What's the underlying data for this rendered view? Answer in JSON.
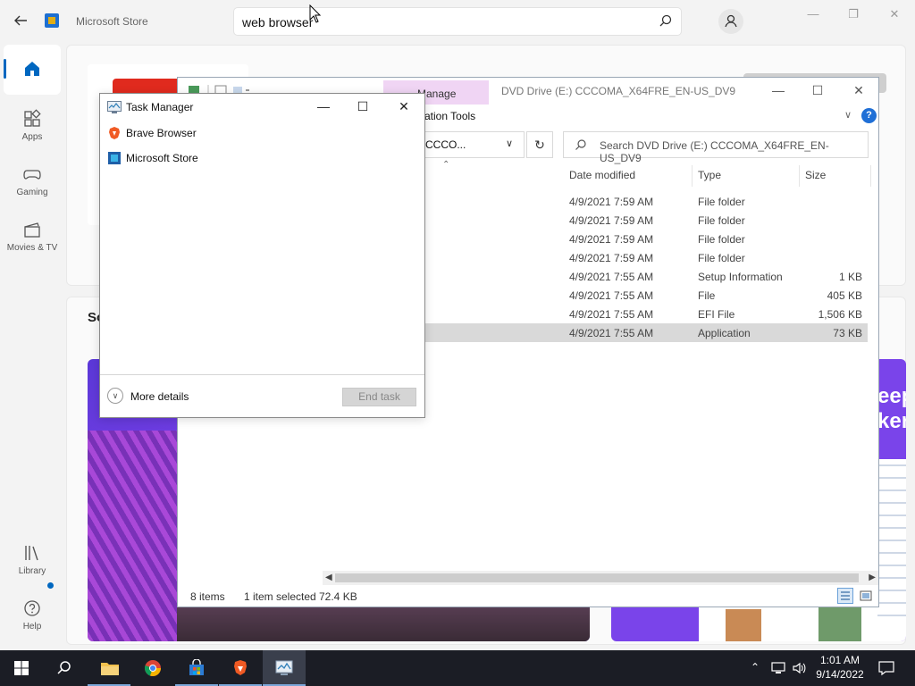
{
  "store": {
    "app_title": "Microsoft Store",
    "search_value": "web browser",
    "partial_section_title": "So",
    "tile_text_line1": "eep",
    "tile_text_line2": "kers",
    "nav": [
      {
        "label": "",
        "icon": "home-icon",
        "active": true
      },
      {
        "label": "Apps",
        "icon": "apps-icon"
      },
      {
        "label": "Gaming",
        "icon": "gaming-icon"
      },
      {
        "label": "Movies & TV",
        "icon": "movies-icon"
      },
      {
        "label": "Library",
        "icon": "library-icon",
        "badge": true
      },
      {
        "label": "Help",
        "icon": "help-icon"
      }
    ]
  },
  "explorer": {
    "title": "DVD Drive (E:) CCCOMA_X64FRE_EN-US_DV9",
    "ribbon_context_tab": "Manage",
    "ribbon_context_group": "ation Tools",
    "address_text": "CCCO...",
    "search_placeholder": "Search DVD Drive (E:) CCCOMA_X64FRE_EN-US_DV9",
    "columns": {
      "date": "Date modified",
      "type": "Type",
      "size": "Size"
    },
    "rows": [
      {
        "date": "4/9/2021 7:59 AM",
        "type": "File folder",
        "size": ""
      },
      {
        "date": "4/9/2021 7:59 AM",
        "type": "File folder",
        "size": ""
      },
      {
        "date": "4/9/2021 7:59 AM",
        "type": "File folder",
        "size": ""
      },
      {
        "date": "4/9/2021 7:59 AM",
        "type": "File folder",
        "size": ""
      },
      {
        "date": "4/9/2021 7:55 AM",
        "type": "Setup Information",
        "size": "1 KB"
      },
      {
        "date": "4/9/2021 7:55 AM",
        "type": "File",
        "size": "405 KB"
      },
      {
        "date": "4/9/2021 7:55 AM",
        "type": "EFI File",
        "size": "1,506 KB"
      },
      {
        "date": "4/9/2021 7:55 AM",
        "type": "Application",
        "size": "73 KB",
        "selected": true
      }
    ],
    "status": {
      "items": "8 items",
      "selected": "1 item selected",
      "size": "72.4 KB"
    }
  },
  "taskmgr": {
    "title": "Task Manager",
    "apps": [
      {
        "name": "Brave Browser",
        "icon": "brave-icon"
      },
      {
        "name": "Microsoft Store",
        "icon": "store-icon"
      }
    ],
    "more_details": "More details",
    "end_task": "End task"
  },
  "taskbar": {
    "time": "1:01 AM",
    "date": "9/14/2022",
    "apps": [
      "start-icon",
      "search-icon",
      "file-explorer-icon",
      "chrome-icon",
      "store-icon",
      "brave-icon",
      "task-manager-icon"
    ]
  },
  "colors": {
    "accent": "#0067c0",
    "taskbar": "#1b1d25",
    "manage_tab": "#f0d5f4",
    "tile_purple": "#7a44ea"
  }
}
